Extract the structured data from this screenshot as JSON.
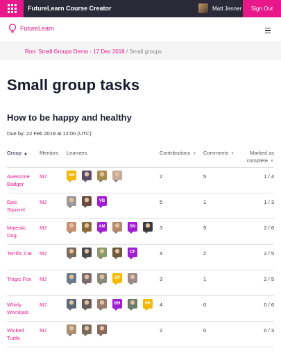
{
  "topbar": {
    "app_title": "FutureLearn Course Creator",
    "user_name": "Matt Jenner",
    "sign_out_label": "Sign Out"
  },
  "header": {
    "logo_text": "FutureLearn"
  },
  "breadcrumb": {
    "run_link": "Run: Small Groups Demo - 17 Dec 2018",
    "separator": "/",
    "current": "Small groups"
  },
  "page": {
    "title": "Small group tasks",
    "section_title": "How to be happy and healthy",
    "due": "Due by: 22 Feb 2019 at 12:00 (UTC)"
  },
  "table": {
    "headers": {
      "group": "Group",
      "mentors": "Mentors",
      "learners": "Learners",
      "contributions": "Contributions",
      "comments": "Comments",
      "marked_line1": "Marked as",
      "marked_line2": "complete"
    },
    "rows": [
      {
        "group_line1": "Awesome",
        "group_line2": "Badger",
        "mentor": "MJ",
        "contributions": "2",
        "comments": "5",
        "marked": "1 / 4",
        "learners": [
          {
            "type": "initials",
            "text": "AM",
            "color": "#f5b800"
          },
          {
            "type": "photo",
            "color": "#5a4a6a"
          },
          {
            "type": "photo",
            "color": "#a88a4a"
          },
          {
            "type": "photo",
            "color": "#c8a898"
          }
        ]
      },
      {
        "group_line1": "Epic",
        "group_line2": "Squirrel",
        "mentor": "MJ",
        "contributions": "5",
        "comments": "1",
        "marked": "1 / 3",
        "learners": [
          {
            "type": "photo",
            "color": "#9a9a9a"
          },
          {
            "type": "photo",
            "color": "#6a4a3a"
          },
          {
            "type": "initials",
            "text": "VB",
            "color": "#a020d0"
          }
        ]
      },
      {
        "group_line1": "Majestic",
        "group_line2": "Dog",
        "mentor": "MJ",
        "contributions": "3",
        "comments": "9",
        "marked": "2 / 6",
        "learners": [
          {
            "type": "photo",
            "color": "#c89070"
          },
          {
            "type": "photo",
            "color": "#8a6a3a"
          },
          {
            "type": "initials",
            "text": "AM",
            "color": "#a020d0"
          },
          {
            "type": "photo",
            "color": "#b08a6a"
          },
          {
            "type": "initials",
            "text": "SN",
            "color": "#a020d0"
          },
          {
            "type": "photo",
            "color": "#3a3a3a"
          }
        ]
      },
      {
        "group_line1": "Terrific Cat",
        "group_line2": "",
        "mentor": "MJ",
        "contributions": "4",
        "comments": "2",
        "marked": "2 / 5",
        "learners": [
          {
            "type": "photo",
            "color": "#7a6a5a"
          },
          {
            "type": "photo",
            "color": "#4a4a4a"
          },
          {
            "type": "photo",
            "color": "#8a9a6a"
          },
          {
            "type": "photo",
            "color": "#6a5a3a"
          },
          {
            "type": "initials",
            "text": "CF",
            "color": "#a020d0"
          }
        ]
      },
      {
        "group_line1": "Tragic Fox",
        "group_line2": "",
        "mentor": "MJ",
        "contributions": "3",
        "comments": "1",
        "marked": "2 / 5",
        "learners": [
          {
            "type": "photo",
            "color": "#6a7a8a"
          },
          {
            "type": "photo",
            "color": "#7a6a6a"
          },
          {
            "type": "photo",
            "color": "#8a8a7a"
          },
          {
            "type": "initials",
            "text": "EP",
            "color": "#f5b800"
          },
          {
            "type": "photo",
            "color": "#9a8a8a"
          }
        ]
      },
      {
        "group_line1": "Whirly",
        "group_line2": "Wombats",
        "mentor": "MJ",
        "contributions": "4",
        "comments": "0",
        "marked": "0 / 6",
        "learners": [
          {
            "type": "photo",
            "color": "#5a6a7a"
          },
          {
            "type": "photo",
            "color": "#6a5a5a"
          },
          {
            "type": "photo",
            "color": "#9a7a6a"
          },
          {
            "type": "initials",
            "text": "BH",
            "color": "#a020d0"
          },
          {
            "type": "photo",
            "color": "#6a7a6a"
          },
          {
            "type": "initials",
            "text": "PK",
            "color": "#f5b800"
          }
        ]
      },
      {
        "group_line1": "Wicked",
        "group_line2": "Turtle",
        "mentor": "MJ",
        "contributions": "2",
        "comments": "0",
        "marked": "0 / 3",
        "learners": [
          {
            "type": "photo",
            "color": "#a89070"
          },
          {
            "type": "photo",
            "color": "#7a6a5a"
          },
          {
            "type": "photo",
            "color": "#8a6a5a"
          }
        ]
      }
    ]
  },
  "colors": {
    "brand": "#e8178a",
    "topbar_dark": "#2a2a38"
  }
}
